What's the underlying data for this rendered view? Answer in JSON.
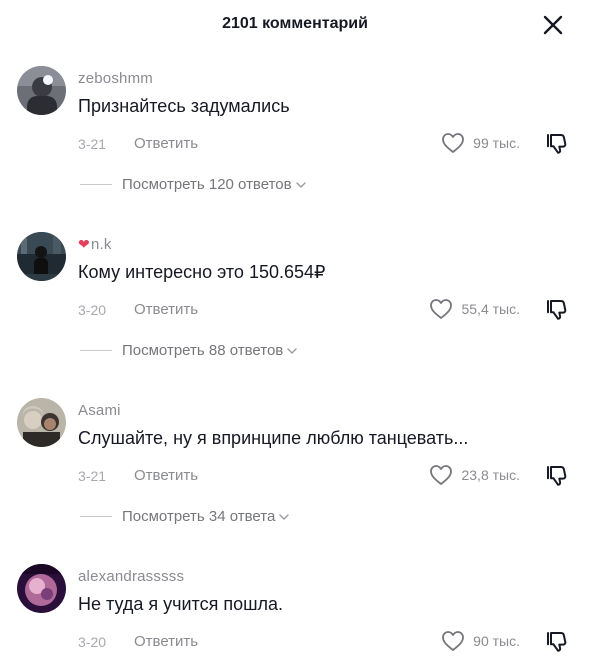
{
  "header": {
    "title": "2101 комментарий"
  },
  "colors": {
    "text": "#161823",
    "muted": "#8a8b91",
    "heart": "#e2405d"
  },
  "comments": [
    {
      "username": "zeboshmm",
      "text": "Признайтесь задумались",
      "date": "3-21",
      "reply_label": "Ответить",
      "likes": "99 тыс.",
      "view_replies": "Посмотреть 120 ответов"
    },
    {
      "username_prefix_icon": "heart-emoji",
      "username": "n.k",
      "text": "Кому интересно это 150.654₽",
      "date": "3-20",
      "reply_label": "Ответить",
      "likes": "55,4 тыс.",
      "view_replies": "Посмотреть 88 ответов"
    },
    {
      "username": "Asami",
      "text": "Слушайте, ну я впринципе люблю танцевать...",
      "date": "3-21",
      "reply_label": "Ответить",
      "likes": "23,8 тыс.",
      "view_replies": "Посмотреть 34 ответа"
    },
    {
      "username": "alexandrasssss",
      "text": "Не туда я учится пошла.",
      "date": "3-20",
      "reply_label": "Ответить",
      "likes": "90 тыс."
    }
  ]
}
